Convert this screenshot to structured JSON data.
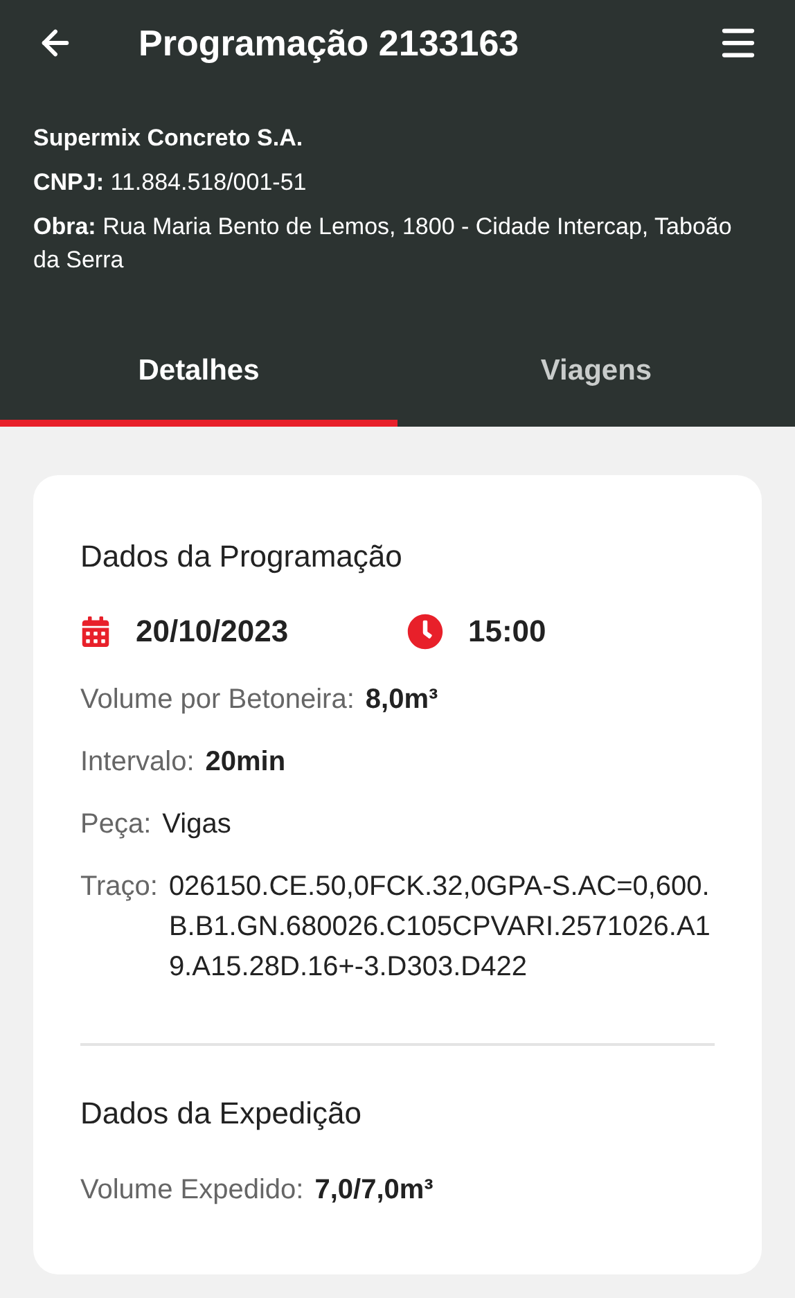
{
  "app_bar": {
    "title": "Programação 2133163"
  },
  "company": {
    "name": "Supermix Concreto S.A.",
    "cnpj_label": "CNPJ:",
    "cnpj": "11.884.518/001-51",
    "obra_label": "Obra:",
    "obra": "Rua Maria Bento de Lemos, 1800 - Cidade Intercap, Taboão da Serra"
  },
  "tabs": [
    {
      "label": "Detalhes",
      "selected": true
    },
    {
      "label": "Viagens",
      "selected": false
    }
  ],
  "sections": [
    {
      "title": "Dados da Programação",
      "date": "20/10/2023",
      "time": "15:00",
      "fields": [
        {
          "label": "Volume por Betoneira:",
          "value": "8,0m³",
          "kind": "strong"
        },
        {
          "label": "Intervalo:",
          "value": "20min",
          "kind": "strong"
        },
        {
          "label": "Peça:",
          "value": "Vigas",
          "kind": "plain"
        },
        {
          "label": "Traço:",
          "value": "026150.CE.50,0FCK.32,0GPA-S.AC=0,600.B.B1.GN.680026.C105CPVARI.2571026.A19.A15.28D.16+-3.D303.D422",
          "kind": "plain"
        }
      ]
    },
    {
      "title": "Dados da Expedição",
      "fields": [
        {
          "label": "Volume Expedido:",
          "value": "7,0/7,0m³",
          "kind": "strong"
        }
      ]
    }
  ]
}
